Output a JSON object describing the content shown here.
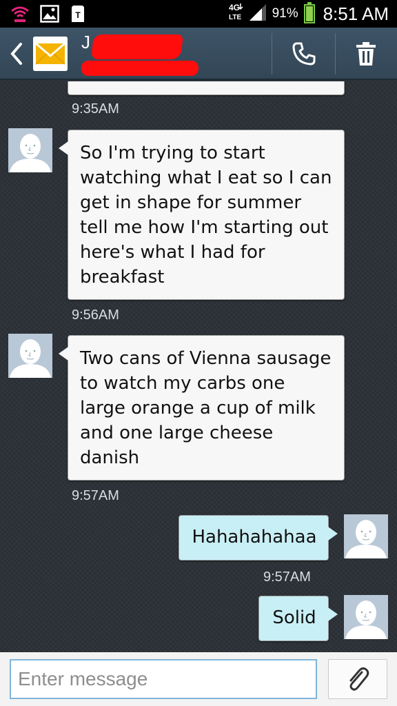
{
  "status_bar": {
    "network": "4G LTE",
    "battery_pct_label": "91%",
    "battery_level": 0.91,
    "time": "8:51 AM"
  },
  "header": {
    "contact_initial": "J",
    "icons": [
      "back-icon",
      "envelope-icon",
      "phone-icon",
      "trash-icon"
    ]
  },
  "conversation": {
    "timestamps": [
      "9:35AM",
      "9:56AM",
      "9:57AM",
      "9:57AM"
    ],
    "messages": [
      {
        "direction": "incoming",
        "text": "So I'm trying to start watching what I eat so I can get in shape for summer tell me how I'm starting out here's what I had for breakfast"
      },
      {
        "direction": "incoming",
        "text": "Two cans of Vienna sausage to watch my carbs one large orange a cup of milk and one large cheese danish"
      },
      {
        "direction": "outgoing",
        "text": "Hahahahahaa"
      },
      {
        "direction": "outgoing",
        "text": "Solid"
      }
    ]
  },
  "composer": {
    "placeholder": "Enter message",
    "value": ""
  },
  "colors": {
    "action_bar": "#3e5467",
    "incoming_bubble": "#f7f7f7",
    "outgoing_bubble": "#c8eff5",
    "background": "#2c3238",
    "redaction": "#ff0d0d"
  }
}
